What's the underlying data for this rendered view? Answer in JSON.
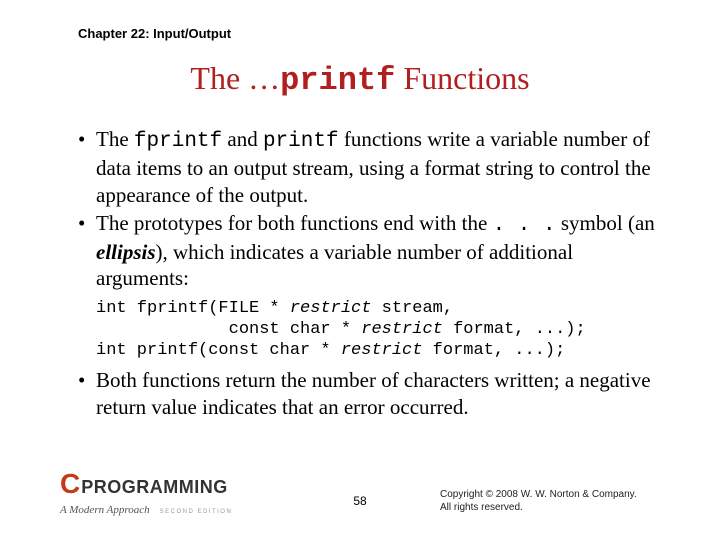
{
  "chapter": "Chapter 22: Input/Output",
  "title": {
    "pre": "The …",
    "mono": "printf",
    "post": " Functions"
  },
  "bullets": [
    {
      "runs": [
        {
          "t": "The "
        },
        {
          "t": "fprintf",
          "mono": true
        },
        {
          "t": " and "
        },
        {
          "t": "printf",
          "mono": true
        },
        {
          "t": " functions write a variable number of data items to an output stream, using a format string to control the appearance of the output."
        }
      ]
    },
    {
      "runs": [
        {
          "t": "The prototypes for both functions end with the "
        },
        {
          "t": ". . .",
          "mono": true
        },
        {
          "t": " symbol (an "
        },
        {
          "t": "ellipsis",
          "em": true
        },
        {
          "t": "), which indicates a variable number of additional arguments:"
        }
      ]
    }
  ],
  "code": [
    [
      {
        "t": "int fprintf(FILE * "
      },
      {
        "t": "restrict",
        "ri": true
      },
      {
        "t": " stream,"
      }
    ],
    [
      {
        "t": "             const char * "
      },
      {
        "t": "restrict",
        "ri": true
      },
      {
        "t": " format, ...);"
      }
    ],
    [
      {
        "t": "int printf(const char * "
      },
      {
        "t": "restrict",
        "ri": true
      },
      {
        "t": " format, ...);"
      }
    ]
  ],
  "bullet3": {
    "runs": [
      {
        "t": "Both functions return the number of characters written; a negative return value indicates that an error occurred."
      }
    ]
  },
  "footer": {
    "logo_c": "C",
    "logo_prog": "PROGRAMMING",
    "logo_sub": "A Modern Approach",
    "logo_ed": "SECOND EDITION",
    "page": "58",
    "copyright1": "Copyright © 2008 W. W. Norton & Company.",
    "copyright2": "All rights reserved."
  }
}
